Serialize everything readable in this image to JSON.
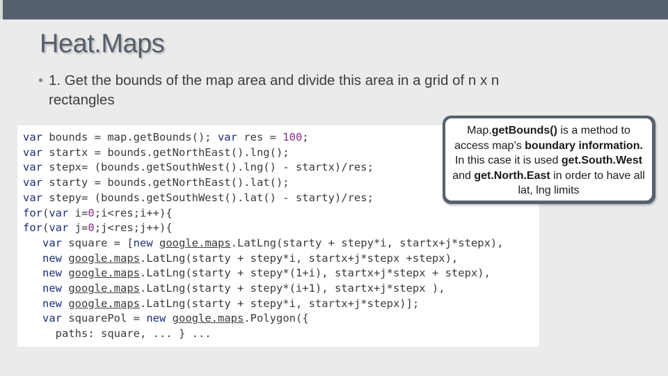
{
  "slide": {
    "title": "Heat.Maps",
    "bullet": {
      "marker": "•",
      "line1": "1. Get the bounds of the map area and divide this area in a grid of n x n",
      "line2": "rectangles"
    }
  },
  "code": {
    "lines": [
      "var bounds = map.getBounds(); var res = 100;",
      "var startx = bounds.getNorthEast().lng();",
      "var stepx= (bounds.getSouthWest().lng() - startx)/res;",
      "var starty = bounds.getNorthEast().lat();",
      "var stepy= (bounds.getSouthWest().lat() - starty)/res;",
      "for(var i=0;i<res;i++){",
      "for(var j=0;j<res;j++){",
      "   var square = [new google.maps.LatLng(starty + stepy*i, startx+j*stepx),",
      "   new google.maps.LatLng(starty + stepy*i, startx+j*stepx +stepx),",
      "   new google.maps.LatLng(starty + stepy*(1+i), startx+j*stepx + stepx),",
      "   new google.maps.LatLng(starty + stepy*(i+1), startx+j*stepx ),",
      "   new google.maps.LatLng(starty + stepy*i, startx+j*stepx)];",
      "   var squarePol = new google.maps.Polygon({",
      "     paths: square, ... } ..."
    ]
  },
  "callout": {
    "parts": [
      {
        "text": "Map.",
        "bold": false
      },
      {
        "text": "getBounds()",
        "bold": true
      },
      {
        "text": " is a method to access map’s ",
        "bold": false
      },
      {
        "text": "boundary information.",
        "bold": true
      },
      {
        "text": " In this case it is used ",
        "bold": false
      },
      {
        "text": "get.South.West",
        "bold": true
      },
      {
        "text": " and ",
        "bold": false
      },
      {
        "text": "get.North.East",
        "bold": true
      },
      {
        "text": " in order to have all lat, lng limits",
        "bold": false
      }
    ]
  },
  "colors": {
    "topbar": "#56616e",
    "background": "#ebebeb",
    "keyword": "#1a2d7a",
    "number": "#8a2a8a"
  }
}
